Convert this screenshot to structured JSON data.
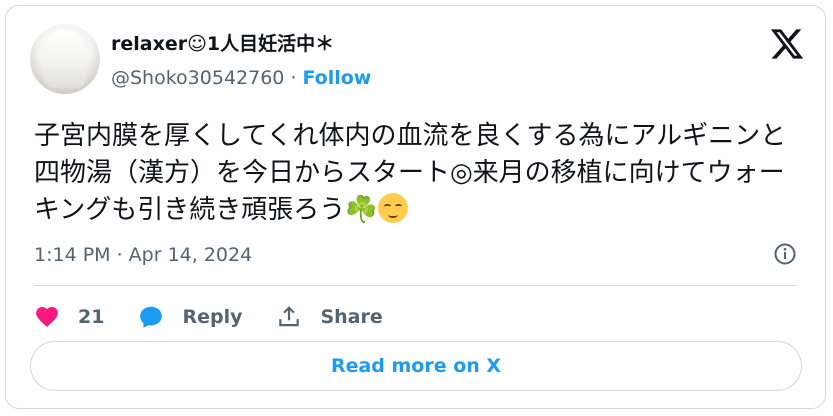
{
  "author": {
    "display_name": "relaxer☺1人目妊活中＊",
    "handle": "@Shoko30542760",
    "separator": "·",
    "follow_label": "Follow"
  },
  "post": {
    "text_part1": "子宮内膜を厚くしてくれ体内の血流を良くする為にアルギニンと四物湯（漢方）を今日からスタート◎来月の移植に向けてウォーキングも引き続き頑張ろう",
    "emoji_1": "☘️",
    "timestamp": "1:14 PM · Apr 14, 2024"
  },
  "actions": {
    "like_count": "21",
    "reply_label": "Reply",
    "share_label": "Share"
  },
  "footer": {
    "read_more_label": "Read more on X"
  },
  "colors": {
    "accent": "#1d9bf0",
    "like": "#f91880",
    "secondary_text": "#536471",
    "border": "#cfd9de"
  },
  "icons": [
    "x-logo-icon",
    "info-icon",
    "heart-icon",
    "reply-bubble-icon",
    "share-icon"
  ]
}
